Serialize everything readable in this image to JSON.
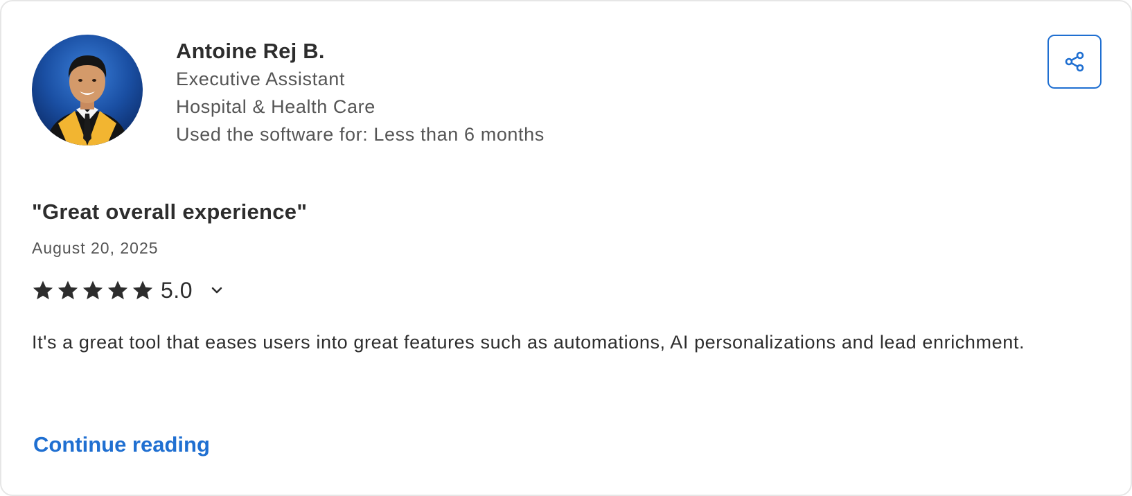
{
  "reviewer": {
    "name": "Antoine Rej B.",
    "role": "Executive Assistant",
    "industry": "Hospital & Health Care",
    "usage": "Used the software for: Less than 6 months"
  },
  "review": {
    "title": "\"Great overall experience\"",
    "date": "August 20, 2025",
    "rating": 5.0,
    "rating_label": "5.0",
    "body": "It's a great tool that eases users into great features such as automations, AI personalizations and lead enrichment.",
    "continue_label": "Continue reading"
  },
  "icons": {
    "share": "share-icon",
    "star": "star-icon",
    "chevron": "chevron-down-icon"
  },
  "colors": {
    "accent": "#1f6fd1",
    "text": "#2d2d2d",
    "muted": "#555555",
    "border": "#e6e6e6"
  }
}
